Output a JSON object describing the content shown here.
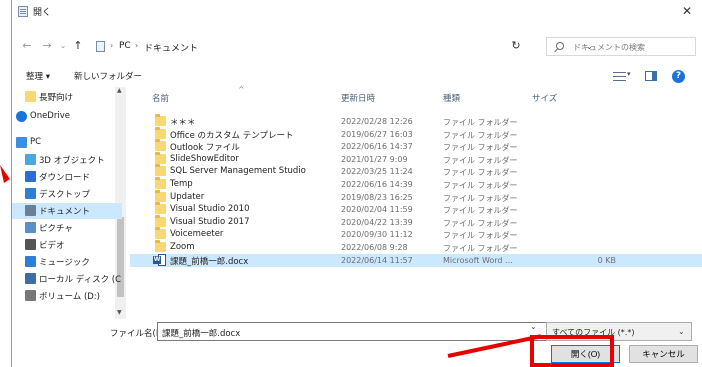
{
  "window": {
    "title": "開く",
    "close_glyph": "✕"
  },
  "nav": {
    "back_glyph": "←",
    "forward_glyph": "→",
    "recent_glyph": "⌄",
    "up_glyph": "↑",
    "breadcrumbs": [
      "PC",
      "ドキュメント"
    ],
    "crumb_sep": "›",
    "dropdown_glyph": "⌄",
    "refresh_glyph": "↻",
    "search_placeholder": "ドキュメントの検索"
  },
  "toolbar": {
    "organize": "整理 ▾",
    "new_folder": "新しいフォルダー",
    "view_drop": "▾",
    "help": "?"
  },
  "sidebar": {
    "items": [
      {
        "label": "長野向け",
        "icon": "folder-icon",
        "color": "#f8d775",
        "indent": 1
      },
      {
        "label": "OneDrive",
        "icon": "cloud-icon",
        "color": "#1a73d9",
        "indent": 0
      },
      {
        "label": "PC",
        "icon": "pc-icon",
        "color": "#3a8ee6",
        "indent": 0
      },
      {
        "label": "3D オブジェクト",
        "icon": "cube-icon",
        "color": "#4aa8e0",
        "indent": 1
      },
      {
        "label": "ダウンロード",
        "icon": "download-icon",
        "color": "#2b6fd6",
        "indent": 1
      },
      {
        "label": "デスクトップ",
        "icon": "desktop-icon",
        "color": "#2b7fd6",
        "indent": 1
      },
      {
        "label": "ドキュメント",
        "icon": "documents-icon",
        "color": "#6a7f99",
        "indent": 1,
        "selected": true
      },
      {
        "label": "ピクチャ",
        "icon": "pictures-icon",
        "color": "#5a8fc8",
        "indent": 1
      },
      {
        "label": "ビデオ",
        "icon": "video-icon",
        "color": "#555",
        "indent": 1
      },
      {
        "label": "ミュージック",
        "icon": "music-icon",
        "color": "#2b7fd6",
        "indent": 1
      },
      {
        "label": "ローカル ディスク (C",
        "icon": "drive-icon",
        "color": "#3a6ea5",
        "indent": 1
      },
      {
        "label": "ボリューム (D:)",
        "icon": "drive-icon",
        "color": "#777",
        "indent": 1
      }
    ],
    "scroll_up": "▲",
    "scroll_down": "▼"
  },
  "filelist": {
    "columns": [
      "名前",
      "更新日時",
      "種類",
      "サイズ"
    ],
    "sort_glyph": "^",
    "rows": [
      {
        "name": "＊＊＊",
        "date": "2022/02/28 12:26",
        "type": "ファイル フォルダー",
        "size": "",
        "kind": "folder"
      },
      {
        "name": "Office のカスタム テンプレート",
        "date": "2019/06/27 16:03",
        "type": "ファイル フォルダー",
        "size": "",
        "kind": "folder"
      },
      {
        "name": "Outlook ファイル",
        "date": "2022/06/16 14:37",
        "type": "ファイル フォルダー",
        "size": "",
        "kind": "folder"
      },
      {
        "name": "SlideShowEditor",
        "date": "2021/01/27 9:09",
        "type": "ファイル フォルダー",
        "size": "",
        "kind": "folder"
      },
      {
        "name": "SQL Server Management Studio",
        "date": "2022/03/25 11:24",
        "type": "ファイル フォルダー",
        "size": "",
        "kind": "folder"
      },
      {
        "name": "Temp",
        "date": "2022/06/16 14:39",
        "type": "ファイル フォルダー",
        "size": "",
        "kind": "folder"
      },
      {
        "name": "Updater",
        "date": "2019/08/23 16:25",
        "type": "ファイル フォルダー",
        "size": "",
        "kind": "folder"
      },
      {
        "name": "Visual Studio 2010",
        "date": "2020/02/04 11:59",
        "type": "ファイル フォルダー",
        "size": "",
        "kind": "folder"
      },
      {
        "name": "Visual Studio 2017",
        "date": "2020/04/22 13:39",
        "type": "ファイル フォルダー",
        "size": "",
        "kind": "folder"
      },
      {
        "name": "Voicemeeter",
        "date": "2020/09/30 11:12",
        "type": "ファイル フォルダー",
        "size": "",
        "kind": "folder"
      },
      {
        "name": "Zoom",
        "date": "2022/06/08 9:28",
        "type": "ファイル フォルダー",
        "size": "",
        "kind": "folder"
      },
      {
        "name": "課題_前橋一郎.docx",
        "date": "2022/06/14 11:57",
        "type": "Microsoft Word ...",
        "size": "0 KB",
        "kind": "doc",
        "selected": true
      }
    ]
  },
  "bottom": {
    "filename_label": "ファイル名(N):",
    "filename_value": "課題_前橋一郎.docx",
    "filename_drop": "⌄",
    "filter_value": "すべてのファイル (*.*)",
    "filter_drop": "⌄",
    "open_label": "開く(O)",
    "cancel_label": "キャンセル"
  },
  "annotations": {
    "highlight_color": "#e60000"
  }
}
